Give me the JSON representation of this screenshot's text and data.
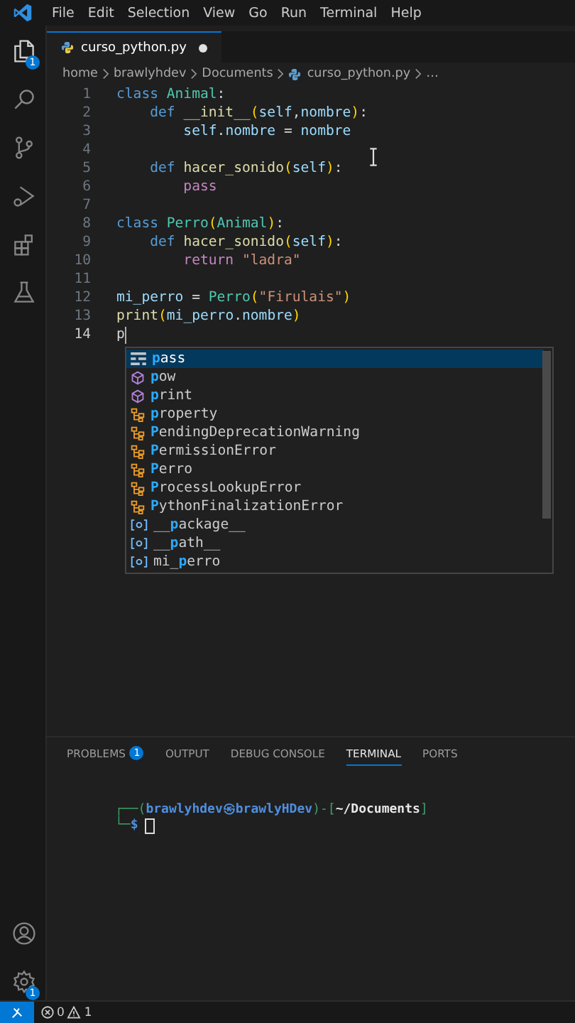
{
  "menu": [
    "File",
    "Edit",
    "Selection",
    "View",
    "Go",
    "Run",
    "Terminal",
    "Help"
  ],
  "activity_bar": {
    "top": [
      {
        "kind": "explorer",
        "badge": "1",
        "selected": true
      },
      {
        "kind": "search",
        "selected": false
      },
      {
        "kind": "source-control",
        "selected": false
      },
      {
        "kind": "run-debug",
        "selected": false
      },
      {
        "kind": "extensions",
        "selected": false
      },
      {
        "kind": "testing",
        "selected": false
      }
    ],
    "bottom": [
      {
        "kind": "account"
      },
      {
        "kind": "settings",
        "badge": "1"
      }
    ]
  },
  "tab": {
    "label": "curso_python.py",
    "modified": true
  },
  "breadcrumb": [
    "home",
    "brawlyhdev",
    "Documents",
    "curso_python.py",
    "…"
  ],
  "code": [
    {
      "number": "1",
      "tokens": [
        {
          "text": "class ",
          "kind": "keyword"
        },
        {
          "text": "Animal",
          "kind": "class"
        },
        {
          "text": ":",
          "kind": "plain"
        }
      ]
    },
    {
      "number": "2",
      "tokens": [
        {
          "text": "    def ",
          "kind": "keyword"
        },
        {
          "text": "__init__",
          "kind": "func"
        },
        {
          "text": "(",
          "kind": "paren"
        },
        {
          "text": "self",
          "kind": "param"
        },
        {
          "text": ",",
          "kind": "plain"
        },
        {
          "text": "nombre",
          "kind": "param"
        },
        {
          "text": ")",
          "kind": "paren"
        },
        {
          "text": ":",
          "kind": "plain"
        }
      ]
    },
    {
      "number": "3",
      "tokens": [
        {
          "text": "        self",
          "kind": "param"
        },
        {
          "text": ".",
          "kind": "plain"
        },
        {
          "text": "nombre",
          "kind": "param"
        },
        {
          "text": " = ",
          "kind": "plain"
        },
        {
          "text": "nombre",
          "kind": "param"
        }
      ]
    },
    {
      "number": "4"
    },
    {
      "number": "5",
      "tokens": [
        {
          "text": "    def ",
          "kind": "keyword"
        },
        {
          "text": "hacer_sonido",
          "kind": "func"
        },
        {
          "text": "(",
          "kind": "paren"
        },
        {
          "text": "self",
          "kind": "param"
        },
        {
          "text": ")",
          "kind": "paren"
        },
        {
          "text": ":",
          "kind": "plain"
        }
      ]
    },
    {
      "number": "6",
      "tokens": [
        {
          "text": "        pass",
          "kind": "control"
        }
      ]
    },
    {
      "number": "7"
    },
    {
      "number": "8",
      "tokens": [
        {
          "text": "class ",
          "kind": "keyword"
        },
        {
          "text": "Perro",
          "kind": "class"
        },
        {
          "text": "(",
          "kind": "paren"
        },
        {
          "text": "Animal",
          "kind": "class"
        },
        {
          "text": ")",
          "kind": "paren"
        },
        {
          "text": ":",
          "kind": "plain"
        }
      ]
    },
    {
      "number": "9",
      "tokens": [
        {
          "text": "    def ",
          "kind": "keyword"
        },
        {
          "text": "hacer_sonido",
          "kind": "func"
        },
        {
          "text": "(",
          "kind": "paren"
        },
        {
          "text": "self",
          "kind": "param"
        },
        {
          "text": ")",
          "kind": "paren"
        },
        {
          "text": ":",
          "kind": "plain"
        }
      ]
    },
    {
      "number": "10",
      "tokens": [
        {
          "text": "        return ",
          "kind": "control"
        },
        {
          "text": "\"ladra\"",
          "kind": "string"
        }
      ]
    },
    {
      "number": "11"
    },
    {
      "number": "12",
      "tokens": [
        {
          "text": "mi_perro",
          "kind": "param"
        },
        {
          "text": " = ",
          "kind": "plain"
        },
        {
          "text": "Perro",
          "kind": "class"
        },
        {
          "text": "(",
          "kind": "paren"
        },
        {
          "text": "\"Firulais\"",
          "kind": "string"
        },
        {
          "text": ")",
          "kind": "paren"
        }
      ]
    },
    {
      "number": "13",
      "tokens": [
        {
          "text": "print",
          "kind": "func"
        },
        {
          "text": "(",
          "kind": "paren"
        },
        {
          "text": "mi_perro",
          "kind": "param"
        },
        {
          "text": ".",
          "kind": "plain"
        },
        {
          "text": "nombre",
          "kind": "param"
        },
        {
          "text": ")",
          "kind": "paren"
        }
      ]
    },
    {
      "number": "14",
      "current": true,
      "tokens": [
        {
          "text": "p",
          "kind": "plain"
        }
      ]
    }
  ],
  "suggestions": [
    {
      "kind": "keyword",
      "selected": true,
      "parts": [
        {
          "text": "p",
          "match": true
        },
        {
          "text": "ass",
          "match": false
        }
      ]
    },
    {
      "kind": "function",
      "selected": false,
      "parts": [
        {
          "text": "p",
          "match": true
        },
        {
          "text": "ow",
          "match": false
        }
      ]
    },
    {
      "kind": "function",
      "selected": false,
      "parts": [
        {
          "text": "p",
          "match": true
        },
        {
          "text": "rint",
          "match": false
        }
      ]
    },
    {
      "kind": "class",
      "selected": false,
      "parts": [
        {
          "text": "p",
          "match": true
        },
        {
          "text": "roperty",
          "match": false
        }
      ]
    },
    {
      "kind": "class",
      "selected": false,
      "parts": [
        {
          "text": "P",
          "match": true
        },
        {
          "text": "endingDeprecationWarning",
          "match": false
        }
      ]
    },
    {
      "kind": "class",
      "selected": false,
      "parts": [
        {
          "text": "P",
          "match": true
        },
        {
          "text": "ermissionError",
          "match": false
        }
      ]
    },
    {
      "kind": "class",
      "selected": false,
      "parts": [
        {
          "text": "P",
          "match": true
        },
        {
          "text": "erro",
          "match": false
        }
      ]
    },
    {
      "kind": "class",
      "selected": false,
      "parts": [
        {
          "text": "P",
          "match": true
        },
        {
          "text": "rocessLookupError",
          "match": false
        }
      ]
    },
    {
      "kind": "class",
      "selected": false,
      "parts": [
        {
          "text": "P",
          "match": true
        },
        {
          "text": "ythonFinalizationError",
          "match": false
        }
      ]
    },
    {
      "kind": "variable",
      "selected": false,
      "parts": [
        {
          "text": "__",
          "match": false
        },
        {
          "text": "p",
          "match": true
        },
        {
          "text": "ackage__",
          "match": false
        }
      ]
    },
    {
      "kind": "variable",
      "selected": false,
      "parts": [
        {
          "text": "__",
          "match": false
        },
        {
          "text": "p",
          "match": true
        },
        {
          "text": "ath__",
          "match": false
        }
      ]
    },
    {
      "kind": "variable",
      "selected": false,
      "parts": [
        {
          "text": "mi_",
          "match": false
        },
        {
          "text": "p",
          "match": true
        },
        {
          "text": "erro",
          "match": false
        }
      ]
    }
  ],
  "panel_tabs": [
    {
      "label": "PROBLEMS",
      "badge": "1",
      "selected": false
    },
    {
      "label": "OUTPUT",
      "selected": false
    },
    {
      "label": "DEBUG CONSOLE",
      "selected": false
    },
    {
      "label": "TERMINAL",
      "selected": true
    },
    {
      "label": "PORTS",
      "selected": false
    }
  ],
  "terminal": [
    {
      "segments": [
        {
          "text": "┌──(",
          "kind": "frame"
        },
        {
          "text": "brawlyhdev㉿brawlyHDev",
          "kind": "user"
        },
        {
          "text": ")-[",
          "kind": "frame"
        },
        {
          "text": "~/Documents",
          "kind": "path"
        },
        {
          "text": "]",
          "kind": "frame"
        }
      ]
    },
    {
      "cursor": true,
      "segments": [
        {
          "text": "└─",
          "kind": "frame"
        },
        {
          "text": "$",
          "kind": "user"
        }
      ]
    }
  ],
  "status_bar": {
    "errors": "0",
    "warnings": "1"
  }
}
